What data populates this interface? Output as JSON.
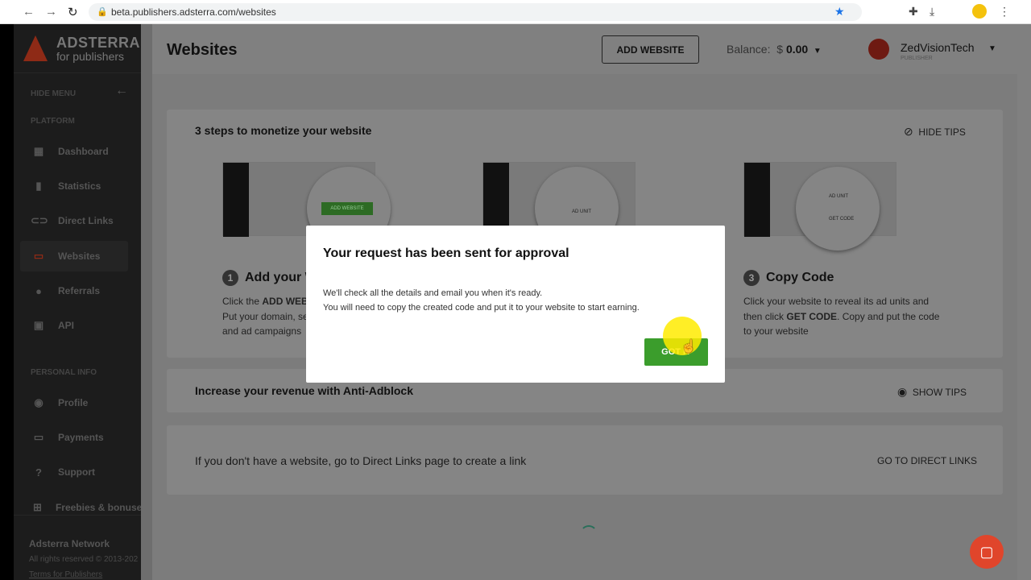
{
  "browser": {
    "url": "beta.publishers.adsterra.com/websites"
  },
  "sidebar": {
    "logo_line1": "ADSTERRA",
    "logo_line2": "for publishers",
    "hide_menu": "HIDE MENU",
    "platform": "PLATFORM",
    "personal": "PERSONAL INFO",
    "items": [
      {
        "label": "Dashboard",
        "icon": "grid-icon"
      },
      {
        "label": "Statistics",
        "icon": "bar-chart-icon"
      },
      {
        "label": "Direct Links",
        "icon": "link-icon"
      },
      {
        "label": "Websites",
        "icon": "monitor-icon",
        "active": true
      },
      {
        "label": "Referrals",
        "icon": "people-icon"
      },
      {
        "label": "API",
        "icon": "terminal-icon"
      },
      {
        "label": "Profile",
        "icon": "user-circle-icon"
      },
      {
        "label": "Payments",
        "icon": "card-icon"
      },
      {
        "label": "Support",
        "icon": "help-icon"
      },
      {
        "label": "Freebies & bonuses",
        "icon": "gift-icon"
      }
    ],
    "footer_title": "Adsterra Network",
    "footer_rights": "All rights reserved © 2013-202",
    "footer_terms": "Terms for Publishers"
  },
  "header": {
    "title": "Websites",
    "add_website": "ADD WEBSITE",
    "balance_label": "Balance:",
    "balance_currency": "$",
    "balance_value": "0.00",
    "user_name": "ZedVisionTech",
    "user_role": "PUBLISHER"
  },
  "tips": {
    "title": "3 steps to monetize your website",
    "hide_tips": "HIDE TIPS",
    "shot1_btn": "ADD WEBSITE",
    "shot2_label": "AD UNIT",
    "shot3_label1": "AD UNIT",
    "shot3_label2": "GET CODE",
    "step1": {
      "num": "1",
      "title": "Add your W",
      "desc_pre": "Click the ",
      "desc_bold": "ADD WEBS",
      "line2": "Put your domain, se",
      "line3": "and ad campaigns"
    },
    "step3": {
      "num": "3",
      "title": "Copy Code",
      "line1": "Click your website to reveal its ad units and",
      "line2_pre": "then click ",
      "line2_bold": "GET CODE",
      "line2_post": ". Copy and put the code",
      "line3": "to your website"
    }
  },
  "antiadblock": {
    "title": "Increase your revenue with Anti-Adblock",
    "show_tips": "SHOW TIPS"
  },
  "directlinks": {
    "text": "If you don't have a website, go to Direct Links page to create a link",
    "button": "GO TO DIRECT LINKS"
  },
  "modal": {
    "title": "Your request has been sent for approval",
    "line1": "We'll check all the details and email you when it's ready.",
    "line2": "You will need to copy the created code and put it to your website to start earning.",
    "button": "GOT IT"
  },
  "colors": {
    "accent": "#3b9d2c",
    "brand": "#c0391b"
  }
}
